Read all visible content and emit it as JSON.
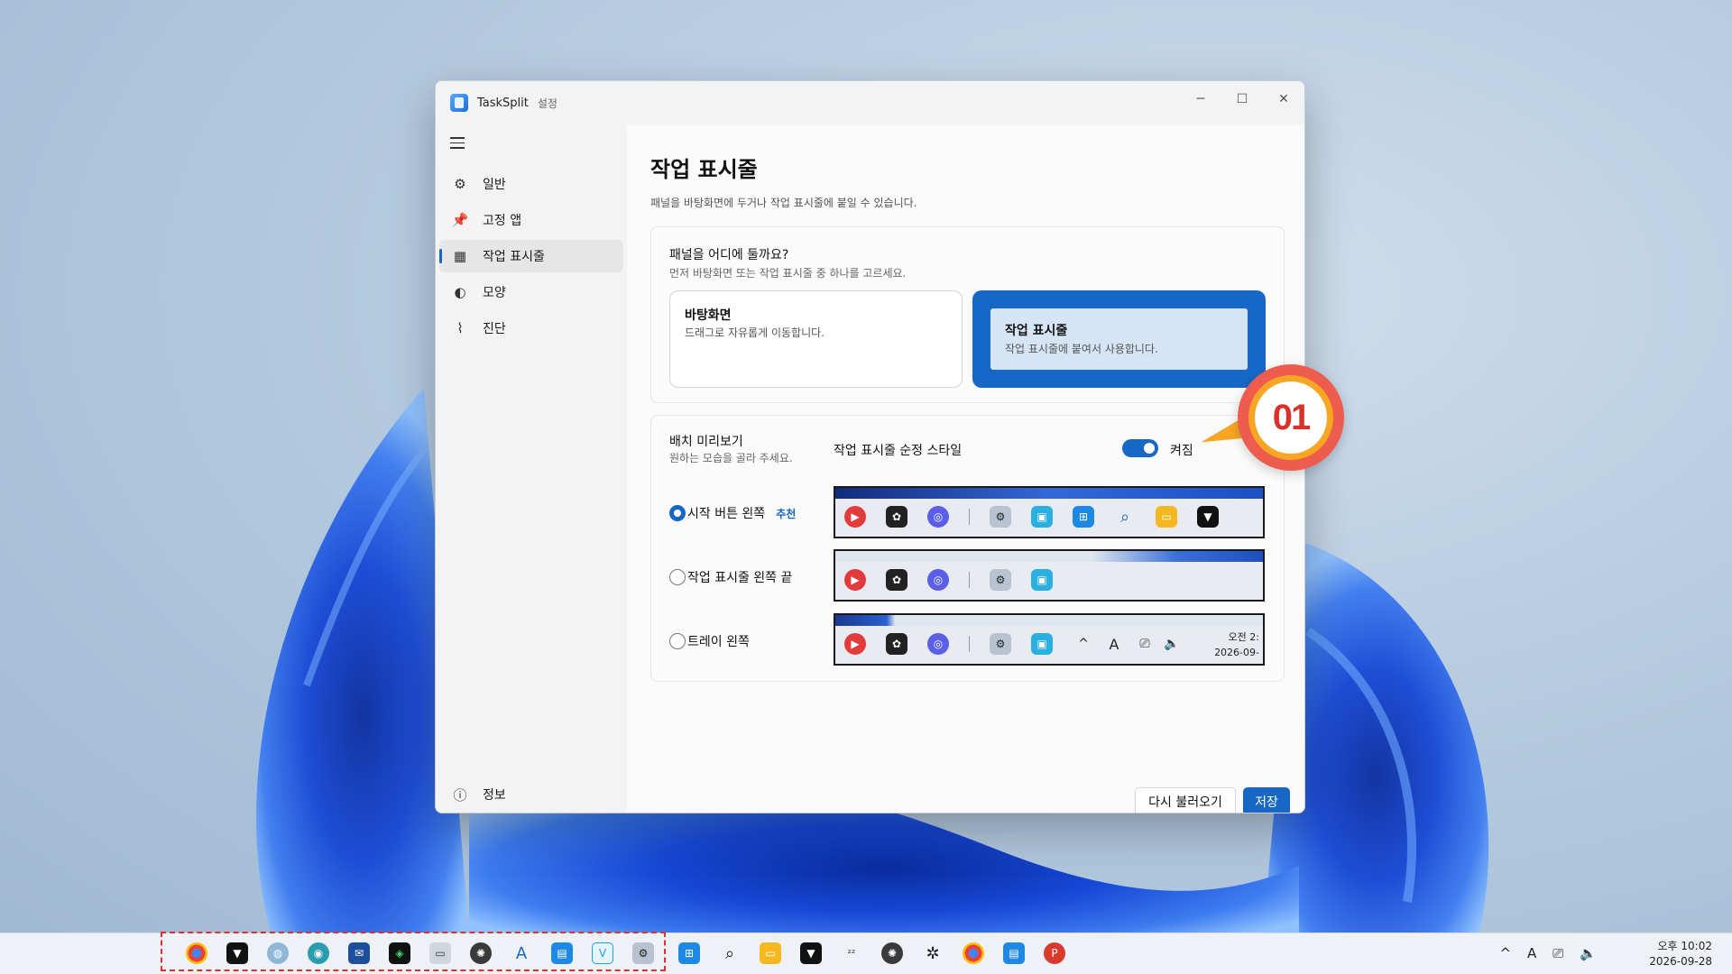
{
  "window": {
    "title": "TaskSplit",
    "subtitle": "설정"
  },
  "controls": {
    "minimize": "─",
    "maximize": "☐",
    "close": "✕"
  },
  "sidebar": {
    "items": [
      {
        "label": "일반",
        "icon": "gear-icon",
        "glyph": "⚙"
      },
      {
        "label": "고정 앱",
        "icon": "pin-icon",
        "glyph": "📌"
      },
      {
        "label": "작업 표시줄",
        "icon": "grid-icon",
        "glyph": "▦",
        "active": true
      },
      {
        "label": "모양",
        "icon": "palette-icon",
        "glyph": "◐"
      },
      {
        "label": "진단",
        "icon": "pulse-icon",
        "glyph": "⌇"
      }
    ],
    "about": {
      "label": "정보",
      "icon": "info-icon",
      "glyph": "ⓘ"
    }
  },
  "page": {
    "title": "작업 표시줄",
    "description": "패널을 바탕화면에 두거나 작업 표시줄에 붙일 수 있습니다."
  },
  "placement": {
    "question": "패널을 어디에 둘까요?",
    "hint": "먼저 바탕화면 또는 작업 표시줄 중 하나를 고르세요.",
    "options": [
      {
        "title": "바탕화면",
        "desc": "드래그로 자유롭게 이동합니다.",
        "selected": false
      },
      {
        "title": "작업 표시줄",
        "desc": "작업 표시줄에 붙여서 사용합니다.",
        "selected": true
      }
    ]
  },
  "preview": {
    "title": "배치 미리보기",
    "hint": "원하는 모습을 골라 주세요.",
    "style_label": "작업 표시줄 순정 스타일",
    "toggle_state": "켜짐",
    "toggle_on": true,
    "positions": [
      {
        "label": "시작 버튼 왼쪽",
        "badge": "추천",
        "selected": true
      },
      {
        "label": "작업 표시줄 왼쪽 끝",
        "badge": "",
        "selected": false
      },
      {
        "label": "트레이 왼쪽",
        "badge": "",
        "selected": false
      }
    ],
    "tray_time": "오전 2:",
    "tray_date": "2026-09-"
  },
  "buttons": {
    "reload": "다시 불러오기",
    "save": "저장"
  },
  "callout": {
    "number": "01"
  },
  "taskbar": {
    "clock_time": "오후 10:02",
    "clock_date": "2026-09-28",
    "tray_glyphs": [
      "^",
      "A",
      "⎚",
      "🔈"
    ]
  },
  "colors": {
    "accent": "#1767c7",
    "callout_red": "#ee5b4f",
    "callout_orange": "#f6a623",
    "dashed_red": "#e0302b"
  }
}
